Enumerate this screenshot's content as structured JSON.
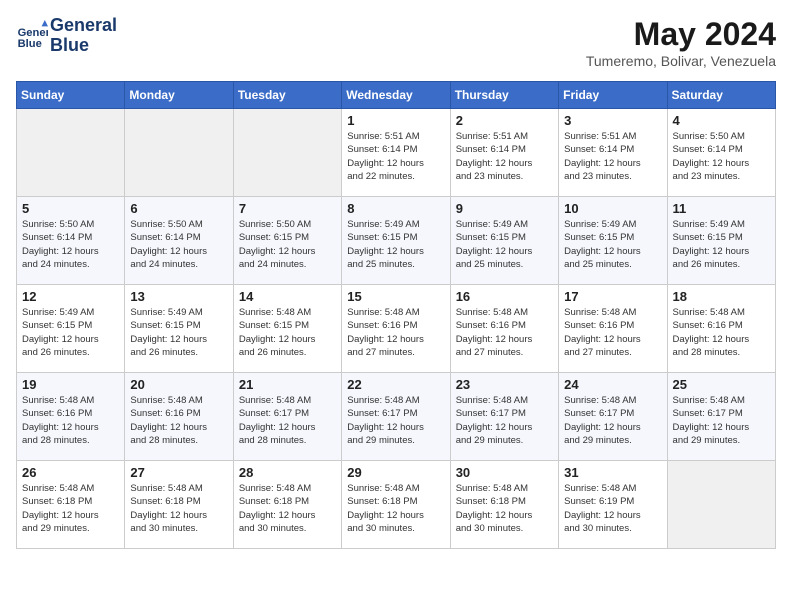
{
  "logo": {
    "line1": "General",
    "line2": "Blue"
  },
  "title": "May 2024",
  "location": "Tumeremo, Bolivar, Venezuela",
  "days_of_week": [
    "Sunday",
    "Monday",
    "Tuesday",
    "Wednesday",
    "Thursday",
    "Friday",
    "Saturday"
  ],
  "weeks": [
    [
      {
        "day": "",
        "info": ""
      },
      {
        "day": "",
        "info": ""
      },
      {
        "day": "",
        "info": ""
      },
      {
        "day": "1",
        "info": "Sunrise: 5:51 AM\nSunset: 6:14 PM\nDaylight: 12 hours\nand 22 minutes."
      },
      {
        "day": "2",
        "info": "Sunrise: 5:51 AM\nSunset: 6:14 PM\nDaylight: 12 hours\nand 23 minutes."
      },
      {
        "day": "3",
        "info": "Sunrise: 5:51 AM\nSunset: 6:14 PM\nDaylight: 12 hours\nand 23 minutes."
      },
      {
        "day": "4",
        "info": "Sunrise: 5:50 AM\nSunset: 6:14 PM\nDaylight: 12 hours\nand 23 minutes."
      }
    ],
    [
      {
        "day": "5",
        "info": "Sunrise: 5:50 AM\nSunset: 6:14 PM\nDaylight: 12 hours\nand 24 minutes."
      },
      {
        "day": "6",
        "info": "Sunrise: 5:50 AM\nSunset: 6:14 PM\nDaylight: 12 hours\nand 24 minutes."
      },
      {
        "day": "7",
        "info": "Sunrise: 5:50 AM\nSunset: 6:15 PM\nDaylight: 12 hours\nand 24 minutes."
      },
      {
        "day": "8",
        "info": "Sunrise: 5:49 AM\nSunset: 6:15 PM\nDaylight: 12 hours\nand 25 minutes."
      },
      {
        "day": "9",
        "info": "Sunrise: 5:49 AM\nSunset: 6:15 PM\nDaylight: 12 hours\nand 25 minutes."
      },
      {
        "day": "10",
        "info": "Sunrise: 5:49 AM\nSunset: 6:15 PM\nDaylight: 12 hours\nand 25 minutes."
      },
      {
        "day": "11",
        "info": "Sunrise: 5:49 AM\nSunset: 6:15 PM\nDaylight: 12 hours\nand 26 minutes."
      }
    ],
    [
      {
        "day": "12",
        "info": "Sunrise: 5:49 AM\nSunset: 6:15 PM\nDaylight: 12 hours\nand 26 minutes."
      },
      {
        "day": "13",
        "info": "Sunrise: 5:49 AM\nSunset: 6:15 PM\nDaylight: 12 hours\nand 26 minutes."
      },
      {
        "day": "14",
        "info": "Sunrise: 5:48 AM\nSunset: 6:15 PM\nDaylight: 12 hours\nand 26 minutes."
      },
      {
        "day": "15",
        "info": "Sunrise: 5:48 AM\nSunset: 6:16 PM\nDaylight: 12 hours\nand 27 minutes."
      },
      {
        "day": "16",
        "info": "Sunrise: 5:48 AM\nSunset: 6:16 PM\nDaylight: 12 hours\nand 27 minutes."
      },
      {
        "day": "17",
        "info": "Sunrise: 5:48 AM\nSunset: 6:16 PM\nDaylight: 12 hours\nand 27 minutes."
      },
      {
        "day": "18",
        "info": "Sunrise: 5:48 AM\nSunset: 6:16 PM\nDaylight: 12 hours\nand 28 minutes."
      }
    ],
    [
      {
        "day": "19",
        "info": "Sunrise: 5:48 AM\nSunset: 6:16 PM\nDaylight: 12 hours\nand 28 minutes."
      },
      {
        "day": "20",
        "info": "Sunrise: 5:48 AM\nSunset: 6:16 PM\nDaylight: 12 hours\nand 28 minutes."
      },
      {
        "day": "21",
        "info": "Sunrise: 5:48 AM\nSunset: 6:17 PM\nDaylight: 12 hours\nand 28 minutes."
      },
      {
        "day": "22",
        "info": "Sunrise: 5:48 AM\nSunset: 6:17 PM\nDaylight: 12 hours\nand 29 minutes."
      },
      {
        "day": "23",
        "info": "Sunrise: 5:48 AM\nSunset: 6:17 PM\nDaylight: 12 hours\nand 29 minutes."
      },
      {
        "day": "24",
        "info": "Sunrise: 5:48 AM\nSunset: 6:17 PM\nDaylight: 12 hours\nand 29 minutes."
      },
      {
        "day": "25",
        "info": "Sunrise: 5:48 AM\nSunset: 6:17 PM\nDaylight: 12 hours\nand 29 minutes."
      }
    ],
    [
      {
        "day": "26",
        "info": "Sunrise: 5:48 AM\nSunset: 6:18 PM\nDaylight: 12 hours\nand 29 minutes."
      },
      {
        "day": "27",
        "info": "Sunrise: 5:48 AM\nSunset: 6:18 PM\nDaylight: 12 hours\nand 30 minutes."
      },
      {
        "day": "28",
        "info": "Sunrise: 5:48 AM\nSunset: 6:18 PM\nDaylight: 12 hours\nand 30 minutes."
      },
      {
        "day": "29",
        "info": "Sunrise: 5:48 AM\nSunset: 6:18 PM\nDaylight: 12 hours\nand 30 minutes."
      },
      {
        "day": "30",
        "info": "Sunrise: 5:48 AM\nSunset: 6:18 PM\nDaylight: 12 hours\nand 30 minutes."
      },
      {
        "day": "31",
        "info": "Sunrise: 5:48 AM\nSunset: 6:19 PM\nDaylight: 12 hours\nand 30 minutes."
      },
      {
        "day": "",
        "info": ""
      }
    ]
  ]
}
